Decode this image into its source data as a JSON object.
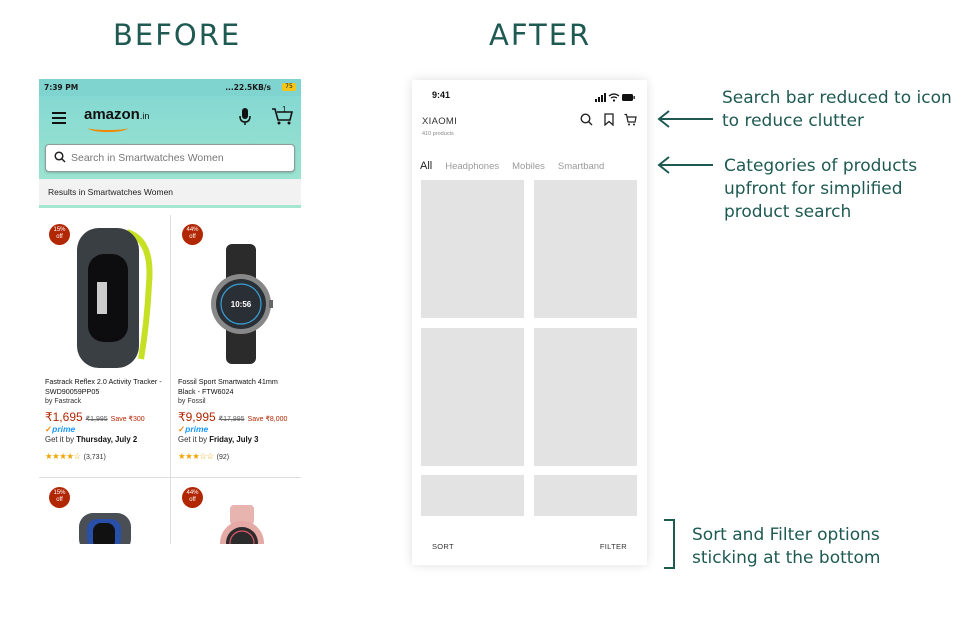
{
  "headings": {
    "before": "BEFORE",
    "after": "AFTER"
  },
  "before": {
    "status": {
      "time": "7:39 PM",
      "right": "...22.5KB/s",
      "battery": "75"
    },
    "logo": {
      "text": "amazon",
      "suffix": ".in"
    },
    "cart_count": "1",
    "search": {
      "placeholder": "Search in Smartwatches Women"
    },
    "results_label": "Results in Smartwatches Women",
    "products": [
      {
        "badge_pct": "15%",
        "badge_off": "off",
        "title": "Fastrack Reflex 2.0 Activity Tracker - SWD90059PP05",
        "by": "by Fastrack",
        "price": "₹1,695",
        "mrp": "₹1,995",
        "save": "Save ₹300",
        "prime": "prime",
        "delivery_prefix": "Get it by ",
        "delivery_date": "Thursday, July 2",
        "stars": "★★★★☆",
        "rating_count": "(3,731)"
      },
      {
        "badge_pct": "44%",
        "badge_off": "off",
        "title": "Fossil Sport Smartwatch 41mm Black - FTW6024",
        "by": "by Fossil",
        "price": "₹9,995",
        "mrp": "₹17,995",
        "save": "Save ₹8,000",
        "prime": "prime",
        "delivery_prefix": "Get it by ",
        "delivery_date": "Friday, July 3",
        "stars": "★★★☆☆",
        "rating_count": "(92)"
      },
      {
        "badge_pct": "15%",
        "badge_off": "off"
      },
      {
        "badge_pct": "44%",
        "badge_off": "off"
      }
    ],
    "watch_face": {
      "time": "10:56"
    }
  },
  "after": {
    "status_time": "9:41",
    "brand": "XIAOMI",
    "product_count": "410 products",
    "tabs": [
      "All",
      "Headphones",
      "Mobiles",
      "Smartband"
    ],
    "sort_label": "SORT",
    "filter_label": "FILTER"
  },
  "notes": {
    "search": [
      "Search bar reduced to icon",
      "to reduce clutter"
    ],
    "categories": [
      "Categories of products",
      "upfront for simplified",
      "product search"
    ],
    "sort_filter": [
      "Sort and Filter options",
      "sticking at the bottom"
    ]
  },
  "colors": {
    "heading": "#1e5a52",
    "header_teal": "#84d9d2",
    "badge_red": "#b12704",
    "placeholder_tile": "#e3e3e3"
  }
}
